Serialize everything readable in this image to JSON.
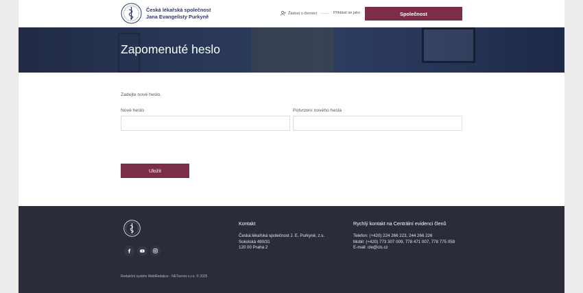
{
  "header": {
    "logo_line1": "Česká lékařská společnost",
    "logo_line2": "Jana Evangelisty Purkyně",
    "membership_label": "Žádost o členství",
    "login_label": "Přihlásit se jako",
    "society_button": "Společnost",
    "icons": {
      "membership": "user-plus-icon",
      "logo": "caduceus-seal-icon"
    }
  },
  "hero": {
    "title": "Zapomenuté heslo"
  },
  "form": {
    "intro": "Zadejte nové heslo.",
    "new_password_label": "Nové heslo",
    "new_password_value": "",
    "confirm_password_label": "Potvrzení nového hesla",
    "confirm_password_value": "",
    "save_button": "Uložit"
  },
  "footer": {
    "contact_heading": "Kontakt",
    "address_line1": "Česká lékařská společnost J. E. Purkyně, z.s.",
    "address_line2": "Sokolská 490/31",
    "address_line3": "120 00 Praha 2",
    "quick_heading": "Rychlý kontakt na Centrální evidenci členů",
    "phone": "Telefon: (+420) 224 266 223, 244 266 226",
    "mobile": "Mobil: (+420) 773 307 009, 778 471 007, 778 775 059",
    "email": "E-mail: cle@cls.cz",
    "copyright": "Redakční systém WebRedakce - NETservis s.r.o. ©  2025",
    "social_icons": [
      "facebook-icon",
      "youtube-icon",
      "instagram-icon"
    ]
  },
  "colors": {
    "accent": "#7b2d4a",
    "footer_bg": "#2a2c39",
    "logo_text": "#2b3a6b",
    "hero_bg": "#34456a"
  }
}
